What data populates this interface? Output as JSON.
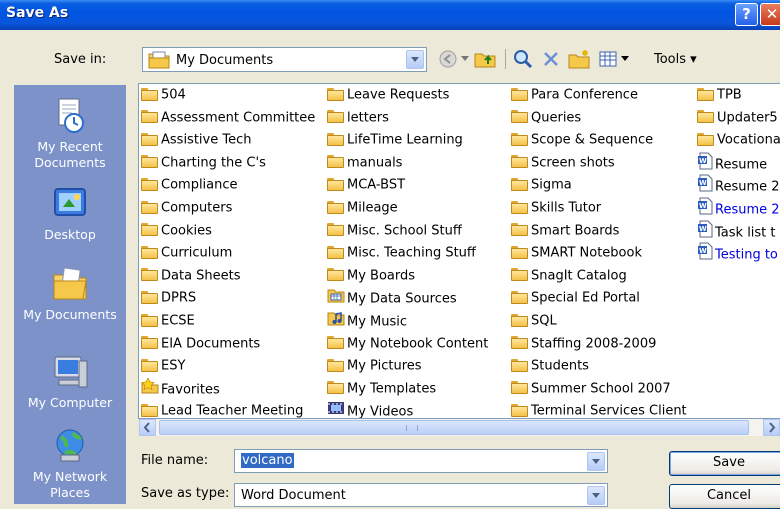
{
  "window": {
    "title": "Save As",
    "help_glyph": "?",
    "close_glyph": "✕"
  },
  "toolbar": {
    "save_in_label": "Save in:",
    "location": "My Documents",
    "tools_label": "Tools",
    "icons": [
      "back-icon",
      "up-folder-icon",
      "search-web-icon",
      "delete-icon",
      "new-folder-icon",
      "views-icon"
    ]
  },
  "places": [
    {
      "label": "My Recent Documents",
      "icon": "recent-documents-icon"
    },
    {
      "label": "Desktop",
      "icon": "desktop-icon"
    },
    {
      "label": "My Documents",
      "icon": "my-documents-icon"
    },
    {
      "label": "My Computer",
      "icon": "my-computer-icon"
    },
    {
      "label": "My Network Places",
      "icon": "network-places-icon"
    }
  ],
  "files": {
    "col1": [
      {
        "name": "504",
        "type": "folder"
      },
      {
        "name": "Assessment Committee",
        "type": "folder"
      },
      {
        "name": "Assistive Tech",
        "type": "folder"
      },
      {
        "name": "Charting the C's",
        "type": "folder"
      },
      {
        "name": "Compliance",
        "type": "folder"
      },
      {
        "name": "Computers",
        "type": "folder"
      },
      {
        "name": "Cookies",
        "type": "folder"
      },
      {
        "name": "Curriculum",
        "type": "folder"
      },
      {
        "name": "Data Sheets",
        "type": "folder"
      },
      {
        "name": "DPRS",
        "type": "folder"
      },
      {
        "name": "ECSE",
        "type": "folder"
      },
      {
        "name": "EIA Documents",
        "type": "folder"
      },
      {
        "name": "ESY",
        "type": "folder"
      },
      {
        "name": "Favorites",
        "type": "favorites"
      },
      {
        "name": "Lead Teacher Meeting",
        "type": "folder"
      }
    ],
    "col2": [
      {
        "name": "Leave Requests",
        "type": "folder"
      },
      {
        "name": "letters",
        "type": "folder"
      },
      {
        "name": "LifeTime Learning",
        "type": "folder"
      },
      {
        "name": "manuals",
        "type": "folder"
      },
      {
        "name": "MCA-BST",
        "type": "folder"
      },
      {
        "name": "Mileage",
        "type": "folder"
      },
      {
        "name": "Misc. School Stuff",
        "type": "folder"
      },
      {
        "name": "Misc. Teaching Stuff",
        "type": "folder"
      },
      {
        "name": "My Boards",
        "type": "folder"
      },
      {
        "name": "My Data Sources",
        "type": "datasource"
      },
      {
        "name": "My Music",
        "type": "music"
      },
      {
        "name": "My Notebook Content",
        "type": "folder"
      },
      {
        "name": "My Pictures",
        "type": "folder"
      },
      {
        "name": "My Templates",
        "type": "folder"
      },
      {
        "name": "My Videos",
        "type": "videos"
      }
    ],
    "col3": [
      {
        "name": "Para Conference",
        "type": "folder"
      },
      {
        "name": "Queries",
        "type": "folder"
      },
      {
        "name": "Scope & Sequence",
        "type": "folder"
      },
      {
        "name": "Screen shots",
        "type": "folder"
      },
      {
        "name": "Sigma",
        "type": "folder"
      },
      {
        "name": "Skills Tutor",
        "type": "folder"
      },
      {
        "name": "Smart Boards",
        "type": "folder"
      },
      {
        "name": "SMART Notebook",
        "type": "folder"
      },
      {
        "name": "SnagIt Catalog",
        "type": "folder"
      },
      {
        "name": "Special Ed Portal",
        "type": "folder"
      },
      {
        "name": "SQL",
        "type": "folder"
      },
      {
        "name": "Staffing 2008-2009",
        "type": "folder"
      },
      {
        "name": "Students",
        "type": "folder"
      },
      {
        "name": "Summer School 2007",
        "type": "folder"
      },
      {
        "name": "Terminal Services Client",
        "type": "folder"
      }
    ],
    "col4": [
      {
        "name": "TPB",
        "type": "folder"
      },
      {
        "name": "Updater5",
        "type": "folder"
      },
      {
        "name": "Vocationa",
        "type": "folder"
      },
      {
        "name": "Resume",
        "type": "doc"
      },
      {
        "name": "Resume 2",
        "type": "doc"
      },
      {
        "name": "Resume 2",
        "type": "doc-link"
      },
      {
        "name": "Task list t",
        "type": "doc"
      },
      {
        "name": "Testing to",
        "type": "doc-link"
      }
    ]
  },
  "form": {
    "file_name_label": "File name:",
    "file_name_value": "volcano",
    "save_as_type_label": "Save as type:",
    "save_as_type_value": "Word Document",
    "save_label": "Save",
    "cancel_label": "Cancel"
  }
}
